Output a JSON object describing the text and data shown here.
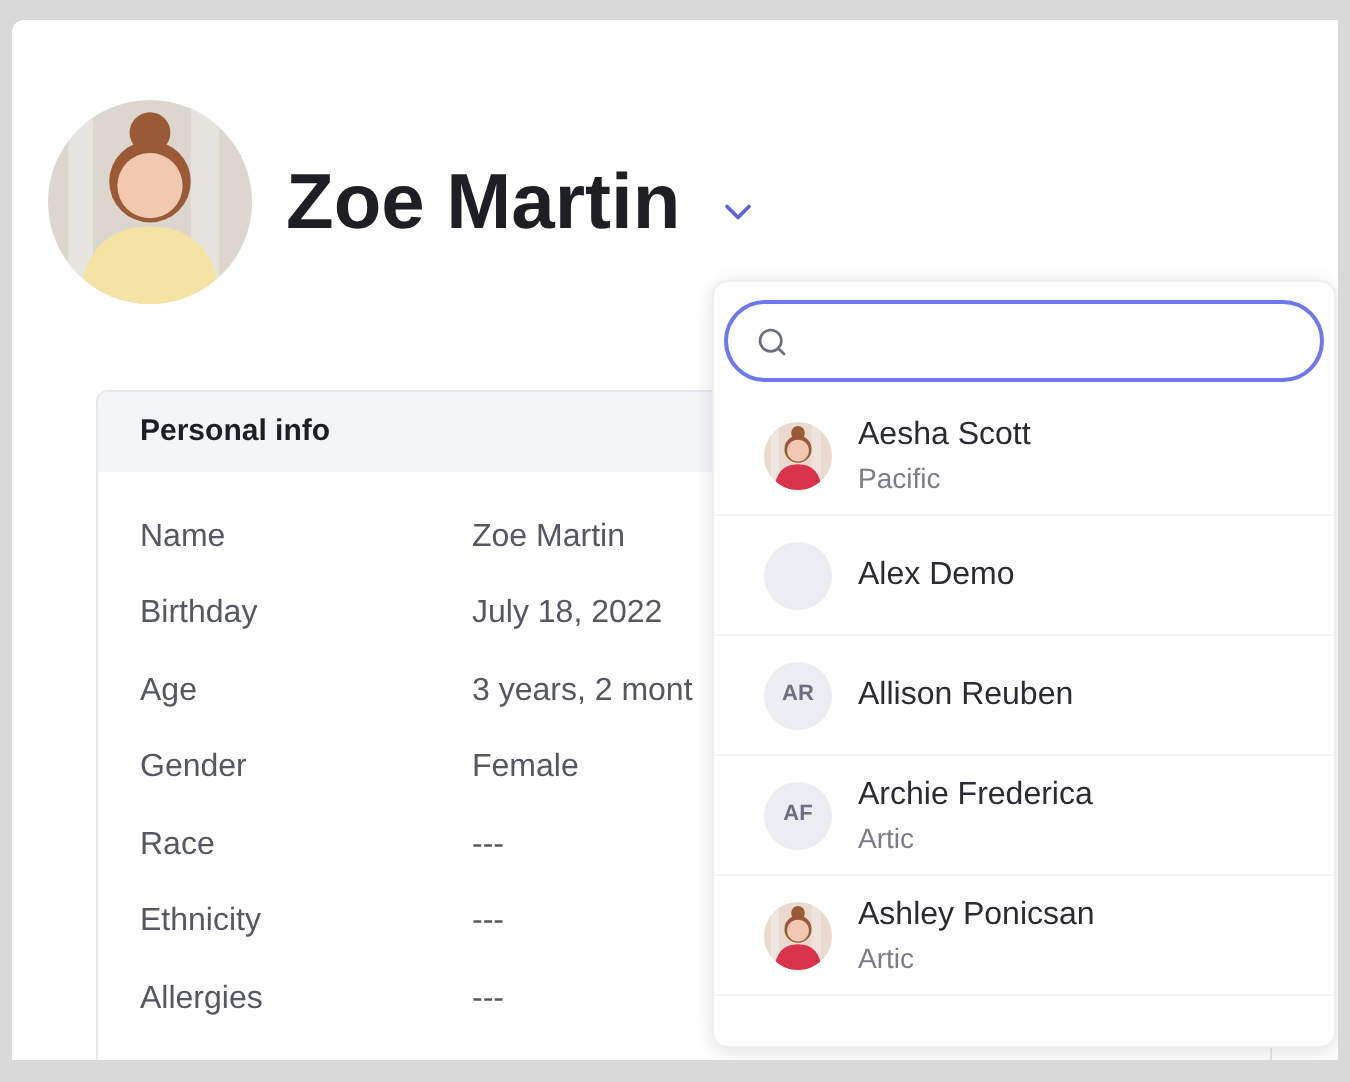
{
  "profile": {
    "name": "Zoe Martin"
  },
  "personal_info": {
    "title": "Personal info",
    "rows": [
      {
        "label": "Name",
        "value": "Zoe Martin"
      },
      {
        "label": "Birthday",
        "value": "July 18, 2022"
      },
      {
        "label": "Age",
        "value": "3 years, 2 mont"
      },
      {
        "label": "Gender",
        "value": "Female"
      },
      {
        "label": "Race",
        "value": "---"
      },
      {
        "label": "Ethnicity",
        "value": "---"
      },
      {
        "label": "Allergies",
        "value": "---"
      }
    ]
  },
  "dropdown": {
    "items": [
      {
        "name": "Aesha Scott",
        "subtitle": "Pacific"
      },
      {
        "kind": "blank",
        "name": "Alex Demo"
      },
      {
        "kind": "initials",
        "initials": "AR",
        "name": "Allison Reuben"
      },
      {
        "kind": "initials",
        "initials": "AF",
        "name": "Archie Frederica",
        "subtitle": "Artic"
      },
      {
        "name": "Ashley Ponicsan",
        "subtitle": "Artic"
      }
    ]
  }
}
